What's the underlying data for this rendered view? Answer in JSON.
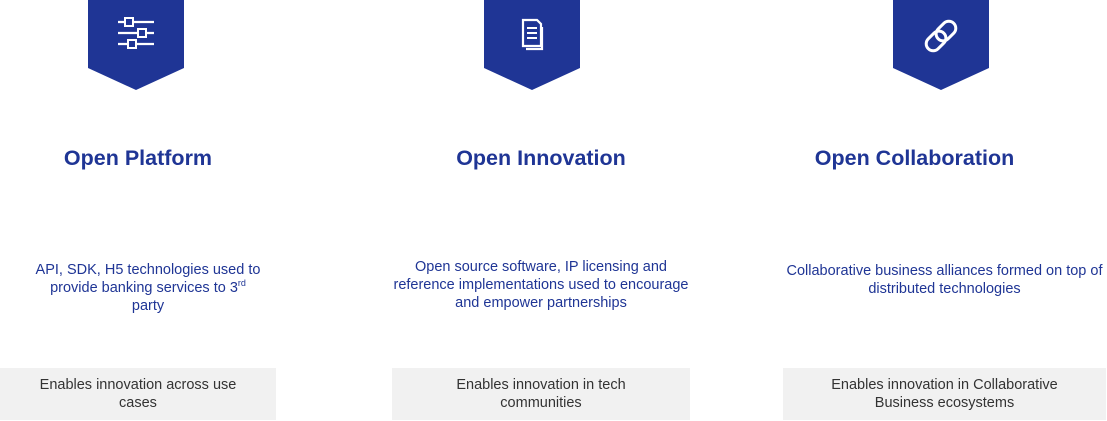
{
  "colors": {
    "brand_blue": "#1f3595",
    "box_bg": "#f1f1f1"
  },
  "columns": [
    {
      "icon": "sliders-icon",
      "title": "Open Platform",
      "desc_main": "API, SDK, H5 technologies used to provide banking services to 3",
      "desc_sup": "rd",
      "desc_tail": "party",
      "box": "Enables innovation across use cases"
    },
    {
      "icon": "document-icon",
      "title": "Open Innovation",
      "desc": "Open source software, IP licensing and reference implementations used to encourage and empower partnerships",
      "box": "Enables innovation in tech communities"
    },
    {
      "icon": "link-icon",
      "title": "Open Collaboration",
      "desc": "Collaborative business alliances formed on top of distributed technologies",
      "box": "Enables innovation in Collaborative Business ecosystems"
    }
  ]
}
